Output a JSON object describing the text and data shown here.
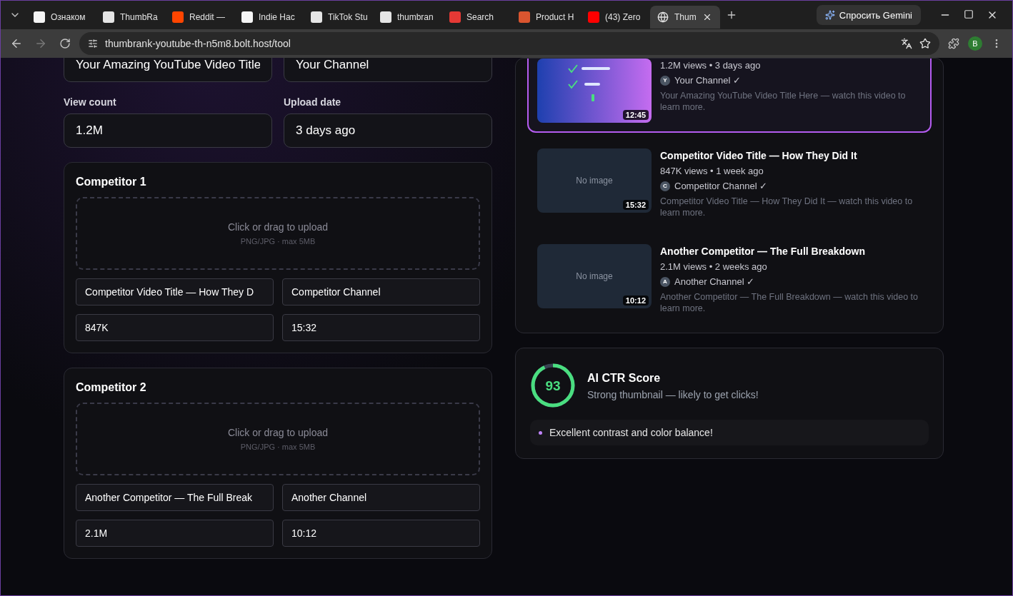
{
  "browser": {
    "tabs": [
      {
        "label": "Ознаком",
        "selected": false
      },
      {
        "label": "ThumbRa",
        "selected": false
      },
      {
        "label": "Reddit —",
        "selected": false
      },
      {
        "label": "Indie Hac",
        "selected": false
      },
      {
        "label": "TikTok Stu",
        "selected": false
      },
      {
        "label": "thumbran",
        "selected": false
      },
      {
        "label": "Search",
        "selected": false
      },
      {
        "label": "Product H",
        "selected": false
      },
      {
        "label": "(43) Zero",
        "selected": false
      },
      {
        "label": "Thum",
        "selected": true
      }
    ],
    "gemini_button": "Спросить Gemini",
    "url": "thumbrank-youtube-th-n5m8.bolt.host/tool",
    "profile": "B"
  },
  "your_video": {
    "fields": [
      {
        "value": "Your Amazing YouTube Video Title"
      },
      {
        "value": "Your Channel"
      }
    ],
    "meta": [
      {
        "label": "View count",
        "value": "1.2M"
      },
      {
        "label": "Upload date",
        "value": "3 days ago"
      }
    ]
  },
  "competitors": [
    {
      "title": "Competitor 1",
      "upload": "Click or drag to upload",
      "hint": "PNG/JPG · max 5MB",
      "fields": [
        "Competitor Video Title — How They D",
        "Competitor Channel",
        "847K",
        "15:32"
      ]
    },
    {
      "title": "Competitor 2",
      "upload": "Click or drag to upload",
      "hint": "PNG/JPG · max 5MB",
      "fields": [
        "Another Competitor — The Full Break",
        "Another Channel",
        "2.1M",
        "10:12"
      ]
    }
  ],
  "preview": [
    {
      "selected": true,
      "duration": "12:45",
      "meta": "1.2M views • 3 days ago",
      "avatar": "Y",
      "channel": "Your Channel ✓",
      "description": "Your Amazing YouTube Video Title Here — watch this video to learn more."
    },
    {
      "kind": "empty",
      "selected": false,
      "placeholder": "No image",
      "duration": "15:32",
      "title": "Competitor Video Title — How They Did It",
      "meta": "847K views • 1 week ago",
      "avatar": "C",
      "channel": "Competitor Channel ✓",
      "description": "Competitor Video Title — How They Did It — watch this video to learn more."
    },
    {
      "kind": "empty",
      "selected": false,
      "placeholder": "No image",
      "duration": "10:12",
      "title": "Another Competitor — The Full Breakdown",
      "meta": "2.1M views • 2 weeks ago",
      "avatar": "A",
      "channel": "Another Channel ✓",
      "description": "Another Competitor — The Full Breakdown — watch this video to learn more."
    }
  ],
  "score": {
    "value": "93",
    "level": 0.93,
    "title": "AI CTR Score",
    "subtitle": "Strong thumbnail — likely to get clicks!",
    "tips": [
      "Excellent contrast and color balance!"
    ]
  }
}
